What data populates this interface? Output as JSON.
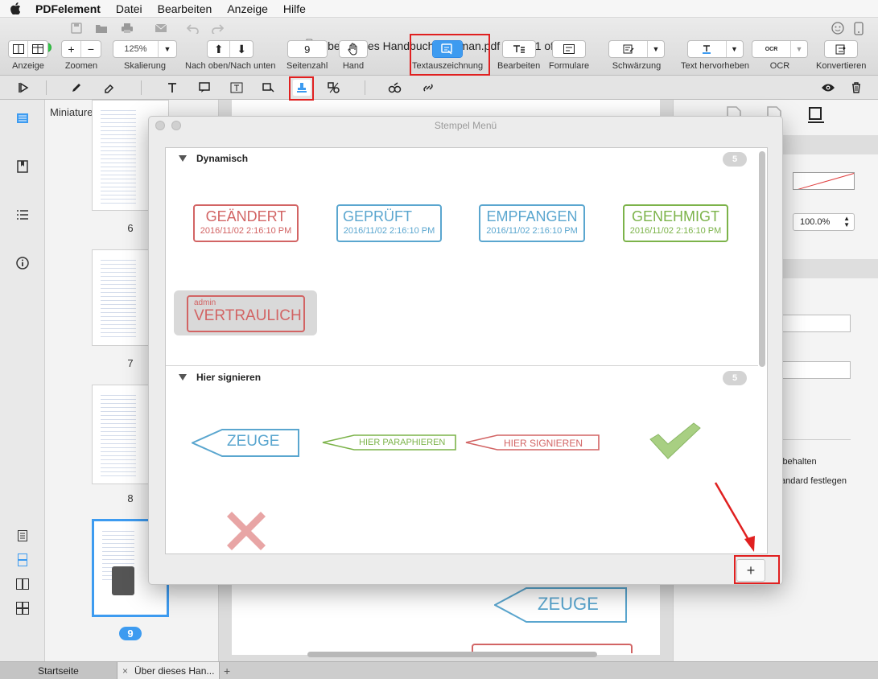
{
  "menubar": {
    "app": "PDFelement",
    "items": [
      "Datei",
      "Bearbeiten",
      "Anzeige",
      "Hilfe"
    ]
  },
  "window": {
    "title": "Über dieses Handbuch_German.pdf (page 1 of 312)"
  },
  "toolbar": {
    "zoom_value": "125%",
    "page_value": "9",
    "labels": {
      "anzeige": "Anzeige",
      "zoomen": "Zoomen",
      "skalierung": "Skalierung",
      "nav": "Nach oben/Nach unten",
      "seitenzahl": "Seitenzahl",
      "hand": "Hand",
      "textauszeichnung": "Textauszeichnung",
      "bearbeiten": "Bearbeiten",
      "formulare": "Formulare",
      "schwaerzung": "Schwärzung",
      "text_hervorheben": "Text hervorheben",
      "ocr": "OCR",
      "konvertieren": "Konvertieren"
    }
  },
  "thumbnails": {
    "header": "Miniaturen",
    "pages": [
      "6",
      "7",
      "8",
      "9"
    ]
  },
  "modal": {
    "title": "Stempel Menü",
    "sections": [
      {
        "name": "Dynamisch",
        "count": "5",
        "stamps": [
          {
            "text": "GEÄNDERT",
            "date": "2016/11/02 2:16:10 PM",
            "color": "#d26464"
          },
          {
            "text": "GEPRÜFT",
            "date": "2016/11/02 2:16:10 PM",
            "color": "#5aa6cf"
          },
          {
            "text": "EMPFANGEN",
            "date": "2016/11/02 2:16:10 PM",
            "color": "#5aa6cf"
          },
          {
            "text": "GENEHMIGT",
            "date": "2016/11/02 2:16:10 PM",
            "color": "#7cb34a"
          },
          {
            "text": "VERTRAULICH",
            "user": "admin",
            "color": "#d26464"
          }
        ]
      },
      {
        "name": "Hier signieren",
        "count": "5",
        "stamps": [
          {
            "text": "ZEUGE",
            "color": "#5aa6cf"
          },
          {
            "text": "HIER PARAPHIEREN",
            "color": "#7cb34a"
          },
          {
            "text": "HIER SIGNIEREN",
            "color": "#d26464"
          }
        ]
      }
    ],
    "add_label": "+"
  },
  "document": {
    "stamp_preview": "ZEUGE"
  },
  "right_panel": {
    "zoom": "100.0%",
    "option1": "ibehalten",
    "option2": "andard festlegen",
    "header_fragment": "d"
  },
  "tabs": {
    "home": "Startseite",
    "doc": "Über dieses Han...",
    "close": "×",
    "new": "+"
  }
}
